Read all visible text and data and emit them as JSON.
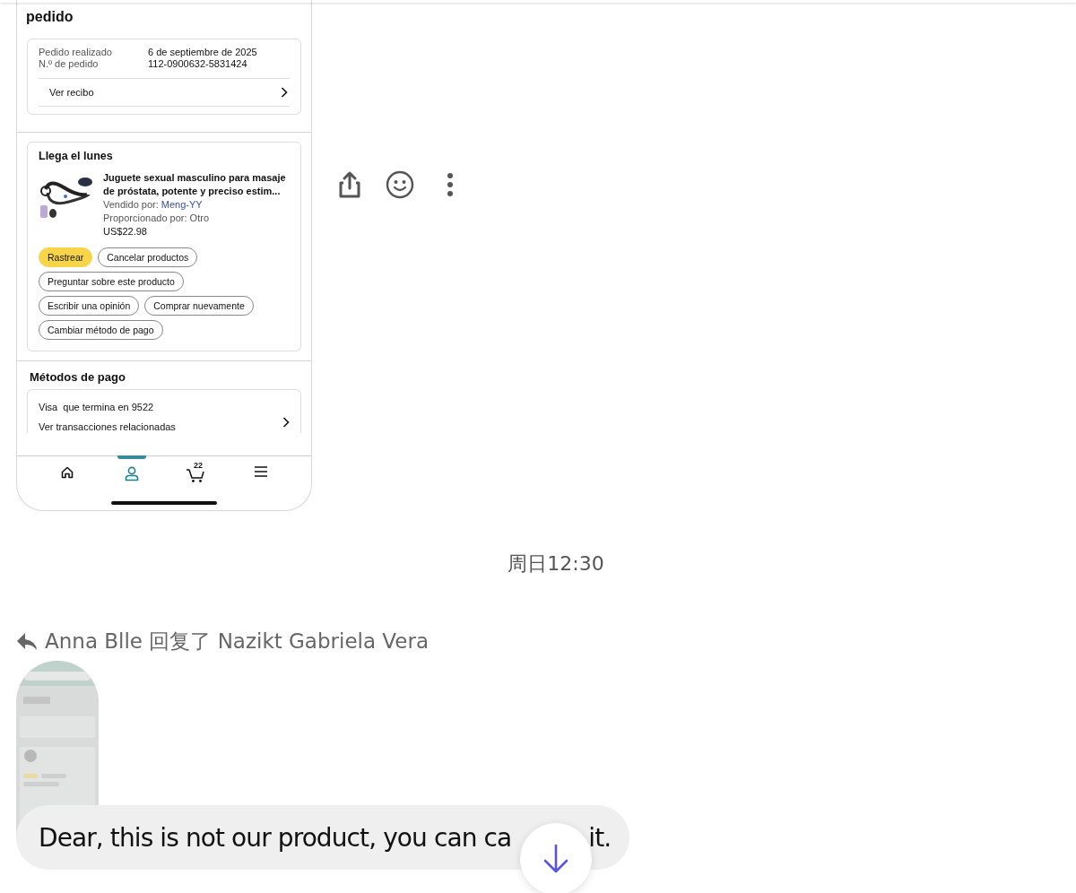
{
  "order_screenshot": {
    "title": "pedido",
    "order_info": [
      {
        "label": "Pedido realizado",
        "value": "6 de septiembre de 2025"
      },
      {
        "label": "N.º de pedido",
        "value": "112-0900632-5831424"
      }
    ],
    "receipt_link": "Ver recibo",
    "delivery": {
      "heading": "Llega el lunes",
      "product_title": "Juguete sexual masculino para masaje de próstata, potente y preciso estim...",
      "seller_label": "Vendido por:",
      "seller": "Meng-YY",
      "provider": "Proporcionado por: Otro",
      "price": "US$22.98",
      "buttons": [
        {
          "label": "Rastrear",
          "kind": "primary"
        },
        {
          "label": "Cancelar productos",
          "kind": "outline"
        },
        {
          "label": "Preguntar sobre este producto",
          "kind": "outline"
        },
        {
          "label": "Escribir una opinión",
          "kind": "outline"
        },
        {
          "label": "Comprar nuevamente",
          "kind": "outline"
        },
        {
          "label": "Cambiar método de pago",
          "kind": "outline"
        }
      ]
    },
    "payment": {
      "heading": "Métodos de pago",
      "card": "Visa  que termina en 9522",
      "transactions_link": "Ver transacciones relacionadas"
    },
    "nav": [
      {
        "kind": "home",
        "selected": false
      },
      {
        "kind": "account",
        "selected": true
      },
      {
        "kind": "cart",
        "badge": "22",
        "selected": false
      },
      {
        "kind": "menu",
        "selected": false
      }
    ]
  },
  "message_actions": [
    {
      "kind": "share"
    },
    {
      "kind": "emoji"
    },
    {
      "kind": "more"
    }
  ],
  "timestamp": "周日12:30",
  "reply": {
    "text": "Anna Blle 回复了 Nazikt Gabriela Vera"
  },
  "message": {
    "text_parts": [
      "Dear, this is not our product, you can ca",
      "it."
    ]
  }
}
